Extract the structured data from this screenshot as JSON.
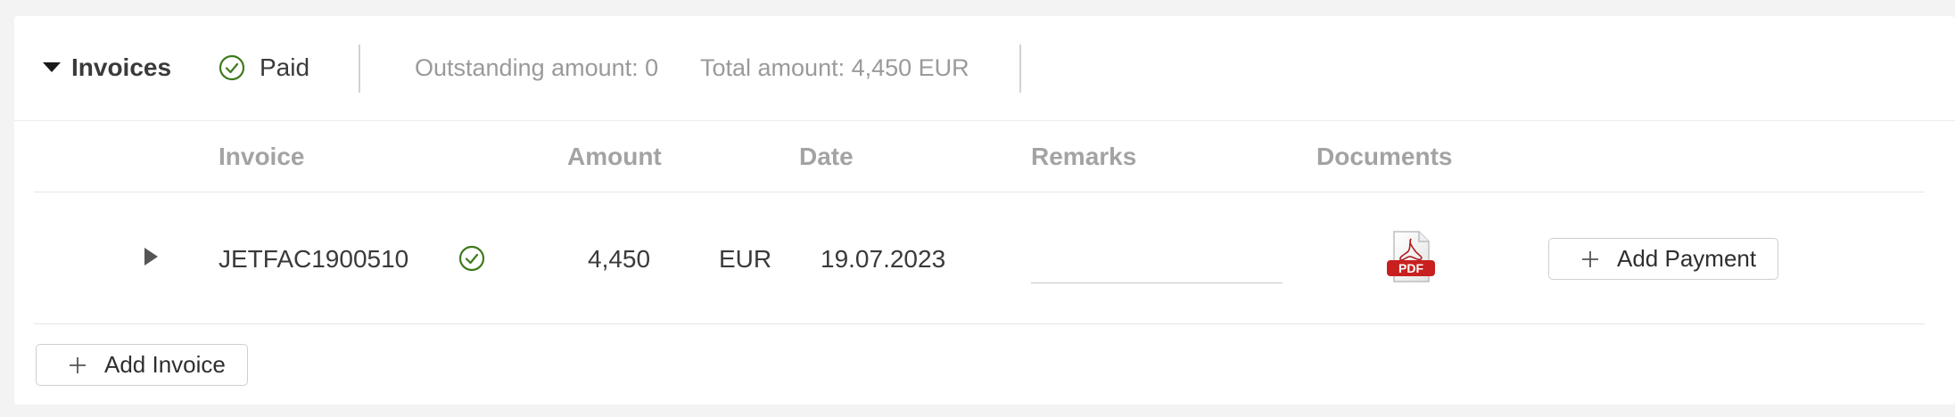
{
  "section": {
    "title": "Invoices",
    "status": "Paid",
    "outstanding": "Outstanding amount: 0",
    "total": "Total amount: 4,450 EUR"
  },
  "table": {
    "columns": [
      "Invoice",
      "Amount",
      "Date",
      "Remarks",
      "Documents"
    ],
    "rows": [
      {
        "invoice": "JETFAC1900510",
        "amount": "4,450",
        "currency": "EUR",
        "date": "19.07.2023",
        "remarks": "",
        "document": "PDF"
      }
    ]
  },
  "buttons": {
    "add_payment": "Add Payment",
    "add_invoice": "Add Invoice"
  },
  "icons": {
    "status": "check-circle-icon",
    "expand_section": "caret-down-icon",
    "expand_row": "caret-right-icon",
    "document": "pdf-file-icon",
    "add": "plus-icon"
  },
  "colors": {
    "success": "#3f7a1e",
    "pdf_red": "#c8201e",
    "muted_text": "#9a9a9a"
  }
}
